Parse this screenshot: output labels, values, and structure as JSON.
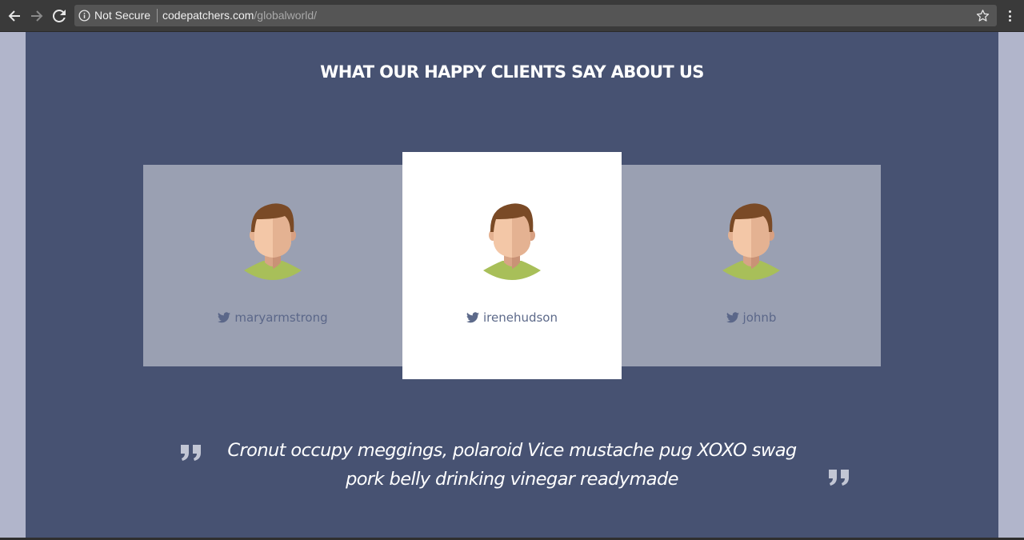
{
  "browser": {
    "security_label": "Not Secure",
    "url_host": "codepatchers.com",
    "url_path": "/globalworld/",
    "icons": [
      "back-arrow-icon",
      "forward-arrow-icon",
      "reload-icon",
      "info-icon",
      "star-icon",
      "menu-icon"
    ]
  },
  "page": {
    "heading": "WHAT OUR HAPPY CLIENTS SAY ABOUT US",
    "testimonials": [
      {
        "handle": "maryarmstrong",
        "icon": "twitter-icon",
        "active": false
      },
      {
        "handle": "irenehudson",
        "icon": "twitter-icon",
        "active": true
      },
      {
        "handle": "johnb",
        "icon": "twitter-icon",
        "active": false
      }
    ],
    "quote": {
      "text": "Cronut occupy meggings, polaroid Vice mustache pug XOXO swag pork belly drinking vinegar readymade",
      "icon": "quote-icon"
    }
  },
  "colors": {
    "section_bg": "#475272",
    "card_inactive": "#9aa0b2",
    "card_active": "#ffffff",
    "handle_text": "#5b6789"
  }
}
